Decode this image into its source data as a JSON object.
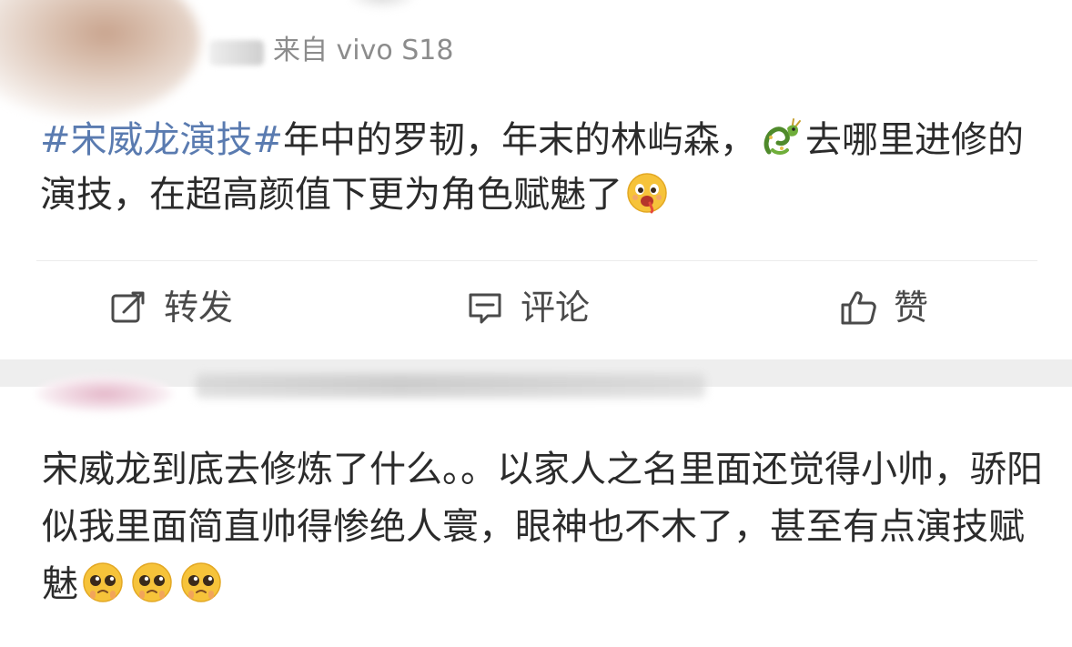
{
  "post": {
    "source": "来自 vivo S18",
    "hashtag": "#宋威龙演技#",
    "text_part1": "年中的罗韧，年末的林屿森，",
    "text_part2": "去哪里进修的演技，在超高颜值下更为角色赋魅了",
    "emojis": [
      "dragon-emoji",
      "drooling-face-emoji"
    ]
  },
  "actions": {
    "repost_label": "转发",
    "comment_label": "评论",
    "like_label": "赞",
    "icons": [
      "repost-icon",
      "comment-icon",
      "thumbs-up-icon"
    ]
  },
  "comment": {
    "text": "宋威龙到底去修炼了什么。。以家人之名里面还觉得小帅，骄阳似我里面简直帅得惨绝人寰，眼神也不木了，甚至有点演技赋魅",
    "emojis": [
      "pleading-face-emoji",
      "pleading-face-emoji",
      "pleading-face-emoji"
    ]
  },
  "colors": {
    "hashtag": "#5a7bb0",
    "text": "#2b2b2b",
    "meta": "#8c8c8c",
    "band": "#eeeeee"
  }
}
